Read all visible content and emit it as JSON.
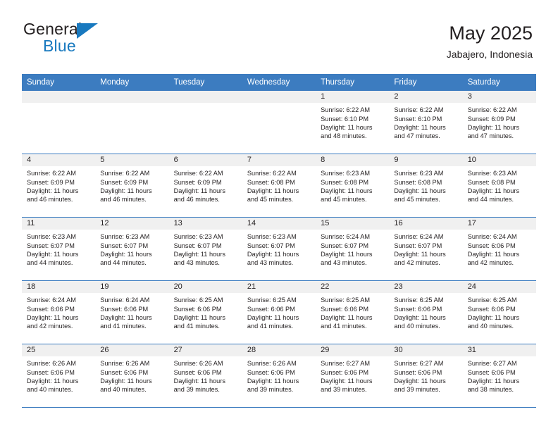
{
  "logo": {
    "word_one": "General",
    "word_two": "Blue",
    "accent_color": "#1879bf"
  },
  "header": {
    "title": "May 2025",
    "subtitle": "Jabajero, Indonesia"
  },
  "theme": {
    "header_blue": "#3c7cc0",
    "day_band_gray": "#f0f0f0",
    "text": "#231f20"
  },
  "weekdays": [
    "Sunday",
    "Monday",
    "Tuesday",
    "Wednesday",
    "Thursday",
    "Friday",
    "Saturday"
  ],
  "weeks": [
    [
      {
        "day": "",
        "sunrise": "",
        "sunset": "",
        "daylight_line1": "",
        "daylight_line2": ""
      },
      {
        "day": "",
        "sunrise": "",
        "sunset": "",
        "daylight_line1": "",
        "daylight_line2": ""
      },
      {
        "day": "",
        "sunrise": "",
        "sunset": "",
        "daylight_line1": "",
        "daylight_line2": ""
      },
      {
        "day": "",
        "sunrise": "",
        "sunset": "",
        "daylight_line1": "",
        "daylight_line2": ""
      },
      {
        "day": "1",
        "sunrise": "Sunrise: 6:22 AM",
        "sunset": "Sunset: 6:10 PM",
        "daylight_line1": "Daylight: 11 hours",
        "daylight_line2": "and 48 minutes."
      },
      {
        "day": "2",
        "sunrise": "Sunrise: 6:22 AM",
        "sunset": "Sunset: 6:10 PM",
        "daylight_line1": "Daylight: 11 hours",
        "daylight_line2": "and 47 minutes."
      },
      {
        "day": "3",
        "sunrise": "Sunrise: 6:22 AM",
        "sunset": "Sunset: 6:09 PM",
        "daylight_line1": "Daylight: 11 hours",
        "daylight_line2": "and 47 minutes."
      }
    ],
    [
      {
        "day": "4",
        "sunrise": "Sunrise: 6:22 AM",
        "sunset": "Sunset: 6:09 PM",
        "daylight_line1": "Daylight: 11 hours",
        "daylight_line2": "and 46 minutes."
      },
      {
        "day": "5",
        "sunrise": "Sunrise: 6:22 AM",
        "sunset": "Sunset: 6:09 PM",
        "daylight_line1": "Daylight: 11 hours",
        "daylight_line2": "and 46 minutes."
      },
      {
        "day": "6",
        "sunrise": "Sunrise: 6:22 AM",
        "sunset": "Sunset: 6:09 PM",
        "daylight_line1": "Daylight: 11 hours",
        "daylight_line2": "and 46 minutes."
      },
      {
        "day": "7",
        "sunrise": "Sunrise: 6:22 AM",
        "sunset": "Sunset: 6:08 PM",
        "daylight_line1": "Daylight: 11 hours",
        "daylight_line2": "and 45 minutes."
      },
      {
        "day": "8",
        "sunrise": "Sunrise: 6:23 AM",
        "sunset": "Sunset: 6:08 PM",
        "daylight_line1": "Daylight: 11 hours",
        "daylight_line2": "and 45 minutes."
      },
      {
        "day": "9",
        "sunrise": "Sunrise: 6:23 AM",
        "sunset": "Sunset: 6:08 PM",
        "daylight_line1": "Daylight: 11 hours",
        "daylight_line2": "and 45 minutes."
      },
      {
        "day": "10",
        "sunrise": "Sunrise: 6:23 AM",
        "sunset": "Sunset: 6:08 PM",
        "daylight_line1": "Daylight: 11 hours",
        "daylight_line2": "and 44 minutes."
      }
    ],
    [
      {
        "day": "11",
        "sunrise": "Sunrise: 6:23 AM",
        "sunset": "Sunset: 6:07 PM",
        "daylight_line1": "Daylight: 11 hours",
        "daylight_line2": "and 44 minutes."
      },
      {
        "day": "12",
        "sunrise": "Sunrise: 6:23 AM",
        "sunset": "Sunset: 6:07 PM",
        "daylight_line1": "Daylight: 11 hours",
        "daylight_line2": "and 44 minutes."
      },
      {
        "day": "13",
        "sunrise": "Sunrise: 6:23 AM",
        "sunset": "Sunset: 6:07 PM",
        "daylight_line1": "Daylight: 11 hours",
        "daylight_line2": "and 43 minutes."
      },
      {
        "day": "14",
        "sunrise": "Sunrise: 6:23 AM",
        "sunset": "Sunset: 6:07 PM",
        "daylight_line1": "Daylight: 11 hours",
        "daylight_line2": "and 43 minutes."
      },
      {
        "day": "15",
        "sunrise": "Sunrise: 6:24 AM",
        "sunset": "Sunset: 6:07 PM",
        "daylight_line1": "Daylight: 11 hours",
        "daylight_line2": "and 43 minutes."
      },
      {
        "day": "16",
        "sunrise": "Sunrise: 6:24 AM",
        "sunset": "Sunset: 6:07 PM",
        "daylight_line1": "Daylight: 11 hours",
        "daylight_line2": "and 42 minutes."
      },
      {
        "day": "17",
        "sunrise": "Sunrise: 6:24 AM",
        "sunset": "Sunset: 6:06 PM",
        "daylight_line1": "Daylight: 11 hours",
        "daylight_line2": "and 42 minutes."
      }
    ],
    [
      {
        "day": "18",
        "sunrise": "Sunrise: 6:24 AM",
        "sunset": "Sunset: 6:06 PM",
        "daylight_line1": "Daylight: 11 hours",
        "daylight_line2": "and 42 minutes."
      },
      {
        "day": "19",
        "sunrise": "Sunrise: 6:24 AM",
        "sunset": "Sunset: 6:06 PM",
        "daylight_line1": "Daylight: 11 hours",
        "daylight_line2": "and 41 minutes."
      },
      {
        "day": "20",
        "sunrise": "Sunrise: 6:25 AM",
        "sunset": "Sunset: 6:06 PM",
        "daylight_line1": "Daylight: 11 hours",
        "daylight_line2": "and 41 minutes."
      },
      {
        "day": "21",
        "sunrise": "Sunrise: 6:25 AM",
        "sunset": "Sunset: 6:06 PM",
        "daylight_line1": "Daylight: 11 hours",
        "daylight_line2": "and 41 minutes."
      },
      {
        "day": "22",
        "sunrise": "Sunrise: 6:25 AM",
        "sunset": "Sunset: 6:06 PM",
        "daylight_line1": "Daylight: 11 hours",
        "daylight_line2": "and 41 minutes."
      },
      {
        "day": "23",
        "sunrise": "Sunrise: 6:25 AM",
        "sunset": "Sunset: 6:06 PM",
        "daylight_line1": "Daylight: 11 hours",
        "daylight_line2": "and 40 minutes."
      },
      {
        "day": "24",
        "sunrise": "Sunrise: 6:25 AM",
        "sunset": "Sunset: 6:06 PM",
        "daylight_line1": "Daylight: 11 hours",
        "daylight_line2": "and 40 minutes."
      }
    ],
    [
      {
        "day": "25",
        "sunrise": "Sunrise: 6:26 AM",
        "sunset": "Sunset: 6:06 PM",
        "daylight_line1": "Daylight: 11 hours",
        "daylight_line2": "and 40 minutes."
      },
      {
        "day": "26",
        "sunrise": "Sunrise: 6:26 AM",
        "sunset": "Sunset: 6:06 PM",
        "daylight_line1": "Daylight: 11 hours",
        "daylight_line2": "and 40 minutes."
      },
      {
        "day": "27",
        "sunrise": "Sunrise: 6:26 AM",
        "sunset": "Sunset: 6:06 PM",
        "daylight_line1": "Daylight: 11 hours",
        "daylight_line2": "and 39 minutes."
      },
      {
        "day": "28",
        "sunrise": "Sunrise: 6:26 AM",
        "sunset": "Sunset: 6:06 PM",
        "daylight_line1": "Daylight: 11 hours",
        "daylight_line2": "and 39 minutes."
      },
      {
        "day": "29",
        "sunrise": "Sunrise: 6:27 AM",
        "sunset": "Sunset: 6:06 PM",
        "daylight_line1": "Daylight: 11 hours",
        "daylight_line2": "and 39 minutes."
      },
      {
        "day": "30",
        "sunrise": "Sunrise: 6:27 AM",
        "sunset": "Sunset: 6:06 PM",
        "daylight_line1": "Daylight: 11 hours",
        "daylight_line2": "and 39 minutes."
      },
      {
        "day": "31",
        "sunrise": "Sunrise: 6:27 AM",
        "sunset": "Sunset: 6:06 PM",
        "daylight_line1": "Daylight: 11 hours",
        "daylight_line2": "and 38 minutes."
      }
    ]
  ]
}
